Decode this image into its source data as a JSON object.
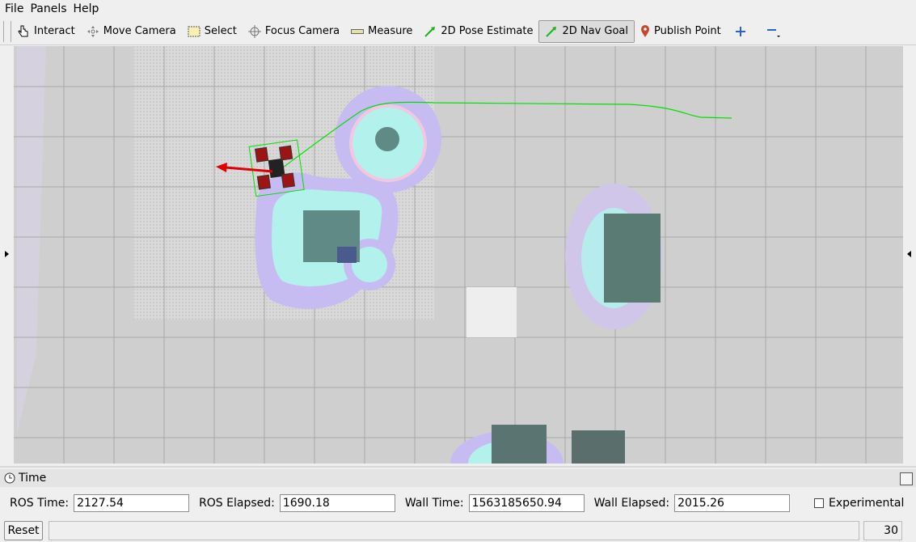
{
  "menu": {
    "file": "File",
    "panels": "Panels",
    "help": "Help"
  },
  "toolbar": {
    "tools": [
      {
        "label": "Interact",
        "icon": "hand-pointer-icon"
      },
      {
        "label": "Move Camera",
        "icon": "move-arrows-icon"
      },
      {
        "label": "Select",
        "icon": "select-rectangle-icon"
      },
      {
        "label": "Focus Camera",
        "icon": "focus-crosshair-icon"
      },
      {
        "label": "Measure",
        "icon": "ruler-icon"
      },
      {
        "label": "2D Pose Estimate",
        "icon": "green-arrow-icon"
      },
      {
        "label": "2D Nav Goal",
        "icon": "green-arrow-icon",
        "active": true
      },
      {
        "label": "Publish Point",
        "icon": "map-pin-icon"
      }
    ],
    "add_icon": "plus-icon",
    "remove_icon": "minus-icon"
  },
  "time_panel": {
    "title": "Time",
    "ros_time_label": "ROS Time:",
    "ros_time": "2127.54",
    "ros_elapsed_label": "ROS Elapsed:",
    "ros_elapsed": "1690.18",
    "wall_time_label": "Wall Time:",
    "wall_time": "1563185650.94",
    "wall_elapsed_label": "Wall Elapsed:",
    "wall_elapsed": "2015.26",
    "experimental_label": "Experimental",
    "experimental_checked": false
  },
  "status": {
    "reset_label": "Reset",
    "fps": "30 fps"
  },
  "colors": {
    "path": "#00e000",
    "pose_arrow": "#e00000",
    "obstacle": "#5f8a86",
    "inflation_cyan": "#b3f1ec",
    "inflation_purple": "#c4b8ee",
    "grid_line": "#a8a8a8",
    "background": "#cfcfcf"
  }
}
